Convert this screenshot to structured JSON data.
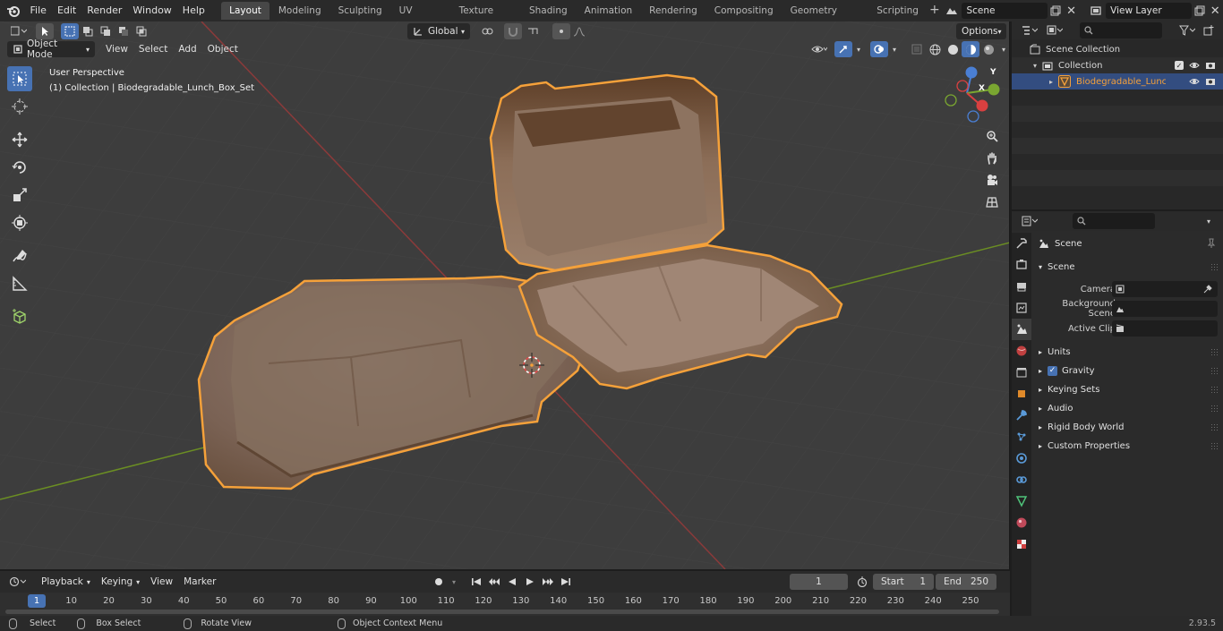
{
  "topbar": {
    "menus": [
      "File",
      "Edit",
      "Render",
      "Window",
      "Help"
    ],
    "workspaces": [
      "Layout",
      "Modeling",
      "Sculpting",
      "UV Editing",
      "Texture Paint",
      "Shading",
      "Animation",
      "Rendering",
      "Compositing",
      "Geometry Nodes",
      "Scripting"
    ],
    "active_workspace": "Layout",
    "scene_name": "Scene",
    "view_layer": "View Layer"
  },
  "viewport": {
    "mode": "Object Mode",
    "menus": [
      "View",
      "Select",
      "Add",
      "Object"
    ],
    "orientation": "Global",
    "options_label": "Options",
    "perspective_label": "User Perspective",
    "collection_label": "(1) Collection | Biodegradable_Lunch_Box_Set",
    "gizmo": {
      "x": "X",
      "y": "Y",
      "z": "Z"
    },
    "colors": {
      "background": "#3d3d3d",
      "grid_x": "#8b3a3a",
      "grid_y": "#6b8e23",
      "selection": "#f5a13a",
      "box": "#8a6a52"
    }
  },
  "timeline": {
    "menus": [
      "Playback",
      "Keying",
      "View",
      "Marker"
    ],
    "current_frame": "1",
    "start_label": "Start",
    "start_value": "1",
    "end_label": "End",
    "end_value": "250",
    "ticks": [
      "1",
      "10",
      "20",
      "30",
      "40",
      "50",
      "60",
      "70",
      "80",
      "90",
      "100",
      "110",
      "120",
      "130",
      "140",
      "150",
      "160",
      "170",
      "180",
      "190",
      "200",
      "210",
      "220",
      "230",
      "240",
      "250"
    ]
  },
  "statusbar": {
    "select": "Select",
    "box_select": "Box Select",
    "rotate_view": "Rotate View",
    "context_menu": "Object Context Menu",
    "version": "2.93.5"
  },
  "outliner": {
    "scene_collection": "Scene Collection",
    "collection": "Collection",
    "object": "Biodegradable_Lunch_Bo"
  },
  "properties": {
    "context": "Scene",
    "panel_scene": "Scene",
    "camera_label": "Camera",
    "background_scene_label": "Background Scene",
    "active_clip_label": "Active Clip",
    "panels": [
      "Units",
      "Gravity",
      "Keying Sets",
      "Audio",
      "Rigid Body World",
      "Custom Properties"
    ],
    "gravity_checked": true
  }
}
